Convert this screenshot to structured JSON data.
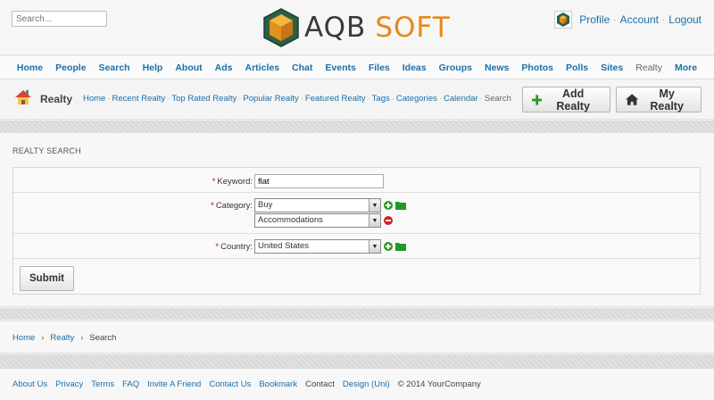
{
  "header": {
    "search_placeholder": "Search...",
    "logo_aqb": "AQB",
    "logo_soft": "SOFT",
    "user_links": [
      "Profile",
      "Account",
      "Logout"
    ]
  },
  "nav": {
    "items": [
      "Home",
      "People",
      "Search",
      "Help",
      "About",
      "Ads",
      "Articles",
      "Chat",
      "Events",
      "Files",
      "Ideas",
      "Groups",
      "News",
      "Photos",
      "Polls",
      "Sites",
      "Realty",
      "More"
    ],
    "active": "Realty"
  },
  "subbar": {
    "title": "Realty",
    "crumbs": [
      "Home",
      "Recent Realty",
      "Top Rated Realty",
      "Popular Realty",
      "Featured Realty",
      "Tags",
      "Categories",
      "Calendar",
      "Search"
    ],
    "add_button": "Add Realty",
    "my_button": "My Realty"
  },
  "search_form": {
    "title": "REALTY SEARCH",
    "keyword_label": "Keyword:",
    "keyword_value": "flat",
    "category_label": "Category:",
    "category_value_1": "Buy",
    "category_value_2": "Accommodations",
    "country_label": "Country:",
    "country_value": "United States",
    "submit_label": "Submit"
  },
  "bottom_breadcrumb": [
    "Home",
    "Realty",
    "Search"
  ],
  "footer": {
    "links": [
      "About Us",
      "Privacy",
      "Terms",
      "FAQ",
      "Invite A Friend",
      "Contact Us",
      "Bookmark",
      "Contact",
      "Design (Uni)"
    ],
    "copyright": "© 2014 YourCompany"
  },
  "colors": {
    "link": "#1b6fa8",
    "brand_orange": "#e38a1a",
    "add_green": "#2a9a2a",
    "remove_red": "#d42020",
    "required_red": "#cc0000"
  }
}
